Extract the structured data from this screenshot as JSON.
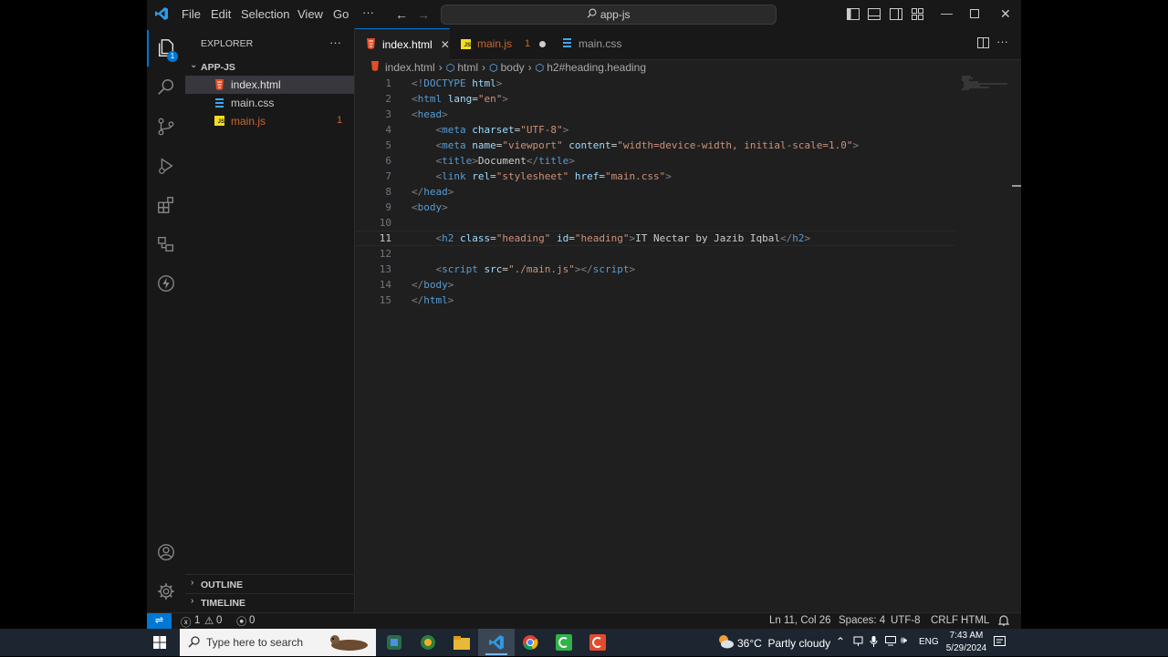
{
  "titlebar": {
    "menu": [
      "File",
      "Edit",
      "Selection",
      "View",
      "Go",
      "···"
    ],
    "command_center": "app-js"
  },
  "activity": {
    "explorer_badge": "1"
  },
  "sidebar": {
    "title": "EXPLORER",
    "more": "···",
    "folder": "APP-JS",
    "files": [
      {
        "name": "index.html",
        "type": "html"
      },
      {
        "name": "main.css",
        "type": "css"
      },
      {
        "name": "main.js",
        "type": "js",
        "problems": "1"
      }
    ],
    "outline": "OUTLINE",
    "timeline": "TIMELINE"
  },
  "tabs": [
    {
      "label": "index.html",
      "active": true
    },
    {
      "label": "main.js",
      "problems": "1",
      "dirty": true
    },
    {
      "label": "main.css"
    }
  ],
  "breadcrumb": [
    "index.html",
    "html",
    "body",
    "h2#heading.heading"
  ],
  "code_lines": [
    {
      "n": "1",
      "tokens": [
        [
          "tg",
          "<!"
        ],
        [
          "tn",
          "DOCTYPE "
        ],
        [
          "at",
          "html"
        ],
        [
          "tg",
          ">"
        ]
      ]
    },
    {
      "n": "2",
      "tokens": [
        [
          "tg",
          "<"
        ],
        [
          "tn",
          "html "
        ],
        [
          "at",
          "lang"
        ],
        [
          "tx",
          "="
        ],
        [
          "st",
          "\"en\""
        ],
        [
          "tg",
          ">"
        ]
      ]
    },
    {
      "n": "3",
      "tokens": [
        [
          "tg",
          "<"
        ],
        [
          "tn",
          "head"
        ],
        [
          "tg",
          ">"
        ]
      ]
    },
    {
      "n": "4",
      "tokens": [
        [
          "tx",
          "    "
        ],
        [
          "tg",
          "<"
        ],
        [
          "tn",
          "meta "
        ],
        [
          "at",
          "charset"
        ],
        [
          "tx",
          "="
        ],
        [
          "st",
          "\"UTF-8\""
        ],
        [
          "tg",
          ">"
        ]
      ]
    },
    {
      "n": "5",
      "tokens": [
        [
          "tx",
          "    "
        ],
        [
          "tg",
          "<"
        ],
        [
          "tn",
          "meta "
        ],
        [
          "at",
          "name"
        ],
        [
          "tx",
          "="
        ],
        [
          "st",
          "\"viewport\" "
        ],
        [
          "at",
          "content"
        ],
        [
          "tx",
          "="
        ],
        [
          "st",
          "\"width=device-width, initial-scale=1.0\""
        ],
        [
          "tg",
          ">"
        ]
      ]
    },
    {
      "n": "6",
      "tokens": [
        [
          "tx",
          "    "
        ],
        [
          "tg",
          "<"
        ],
        [
          "tn",
          "title"
        ],
        [
          "tg",
          ">"
        ],
        [
          "tx",
          "Document"
        ],
        [
          "tg",
          "</"
        ],
        [
          "tn",
          "title"
        ],
        [
          "tg",
          ">"
        ]
      ]
    },
    {
      "n": "7",
      "tokens": [
        [
          "tx",
          "    "
        ],
        [
          "tg",
          "<"
        ],
        [
          "tn",
          "link "
        ],
        [
          "at",
          "rel"
        ],
        [
          "tx",
          "="
        ],
        [
          "st",
          "\"stylesheet\" "
        ],
        [
          "at",
          "href"
        ],
        [
          "tx",
          "="
        ],
        [
          "st",
          "\"main.css\""
        ],
        [
          "tg",
          ">"
        ]
      ]
    },
    {
      "n": "8",
      "tokens": [
        [
          "tg",
          "</"
        ],
        [
          "tn",
          "head"
        ],
        [
          "tg",
          ">"
        ]
      ]
    },
    {
      "n": "9",
      "tokens": [
        [
          "tg",
          "<"
        ],
        [
          "tn",
          "body"
        ],
        [
          "tg",
          ">"
        ]
      ]
    },
    {
      "n": "10",
      "tokens": []
    },
    {
      "n": "11",
      "tokens": [
        [
          "tx",
          "    "
        ],
        [
          "tg",
          "<"
        ],
        [
          "tn",
          "h2 "
        ],
        [
          "at",
          "class"
        ],
        [
          "tx",
          "="
        ],
        [
          "st",
          "\"heading\" "
        ],
        [
          "at",
          "id"
        ],
        [
          "tx",
          "="
        ],
        [
          "st",
          "\"heading\""
        ],
        [
          "tg",
          ">"
        ],
        [
          "tx",
          "IT Nectar by Jazib Iqbal"
        ],
        [
          "tg",
          "</"
        ],
        [
          "tn",
          "h2"
        ],
        [
          "tg",
          ">"
        ]
      ]
    },
    {
      "n": "12",
      "tokens": []
    },
    {
      "n": "13",
      "tokens": [
        [
          "tx",
          "    "
        ],
        [
          "tg",
          "<"
        ],
        [
          "tn",
          "script "
        ],
        [
          "at",
          "src"
        ],
        [
          "tx",
          "="
        ],
        [
          "st",
          "\"./main.js\""
        ],
        [
          "tg",
          "></"
        ],
        [
          "tn",
          "script"
        ],
        [
          "tg",
          ">"
        ]
      ]
    },
    {
      "n": "14",
      "tokens": [
        [
          "tg",
          "</"
        ],
        [
          "tn",
          "body"
        ],
        [
          "tg",
          ">"
        ]
      ]
    },
    {
      "n": "15",
      "tokens": [
        [
          "tg",
          "</"
        ],
        [
          "tn",
          "html"
        ],
        [
          "tg",
          ">"
        ]
      ]
    }
  ],
  "status": {
    "errors": "1",
    "warnings": "0",
    "ports": "0",
    "cursor": "Ln 11, Col 26",
    "spaces": "Spaces: 4",
    "encoding": "UTF-8",
    "eol": "CRLF",
    "language": "HTML"
  },
  "taskbar": {
    "search_placeholder": "Type here to search",
    "weather": "36°C  Partly cloudy",
    "lang": "ENG",
    "time": "7:43 AM",
    "date": "5/29/2024"
  },
  "colors": {
    "accent": "#0078d4",
    "html_icon": "#e44d26",
    "css_icon": "#42a5f5",
    "js_icon": "#f5de19",
    "problem": "#cc6633"
  }
}
